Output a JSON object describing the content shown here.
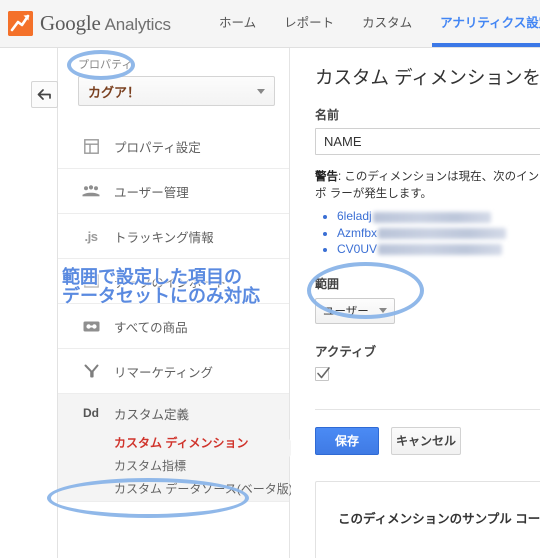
{
  "header": {
    "brand_google": "Google",
    "brand_analytics": "Analytics",
    "logo_icon": "analytics-logo-icon",
    "nav": [
      {
        "label": "ホーム",
        "active": false
      },
      {
        "label": "レポート",
        "active": false
      },
      {
        "label": "カスタム",
        "active": false
      },
      {
        "label": "アナリティクス設定",
        "active": true
      }
    ]
  },
  "rail": {
    "back_icon": "back-arrow-icon"
  },
  "sidebar": {
    "property_label": "プロパティ",
    "property_value": "カグア！",
    "items": [
      {
        "label": "プロパティ設定",
        "icon": "property-settings-icon"
      },
      {
        "label": "ユーザー管理",
        "icon": "users-icon"
      },
      {
        "label": "トラッキング情報",
        "icon": "js-icon"
      },
      {
        "label": "データのインポート",
        "icon": "import-icon"
      },
      {
        "label": "すべての商品",
        "icon": "products-icon"
      },
      {
        "label": "リマーケティング",
        "icon": "remarketing-icon"
      }
    ],
    "custom_definitions": {
      "label": "カスタム定義",
      "icon": "dd-icon",
      "sub_items": [
        {
          "label": "カスタム ディメンション",
          "selected": true
        },
        {
          "label": "カスタム指標",
          "selected": false
        },
        {
          "label": "カスタム データソース(ベータ版)",
          "selected": false
        }
      ]
    }
  },
  "main": {
    "title": "カスタム ディメンションを編集",
    "name_label": "名前",
    "name_value": "NAME",
    "warning_prefix": "警告",
    "warning_text": ": このディメンションは現在、次のインポ ラーが発生します。",
    "warning_items": [
      {
        "text": "6leladj"
      },
      {
        "text": "Azmfbx"
      },
      {
        "text": "CV0UV"
      }
    ],
    "scope_label": "範囲",
    "scope_value": "ユーザー",
    "active_label": "アクティブ",
    "active_checked": true,
    "check_icon": "checkmark-icon",
    "save_label": "保存",
    "cancel_label": "キャンセル",
    "sample_title": "このディメンションのサンプル コー"
  },
  "annotations": {
    "note_line1": "範囲で設定した項目の",
    "note_line2": "データセットにのみ対応",
    "accent_color": "#8ab4e8",
    "note_color": "#5a8ae0"
  }
}
